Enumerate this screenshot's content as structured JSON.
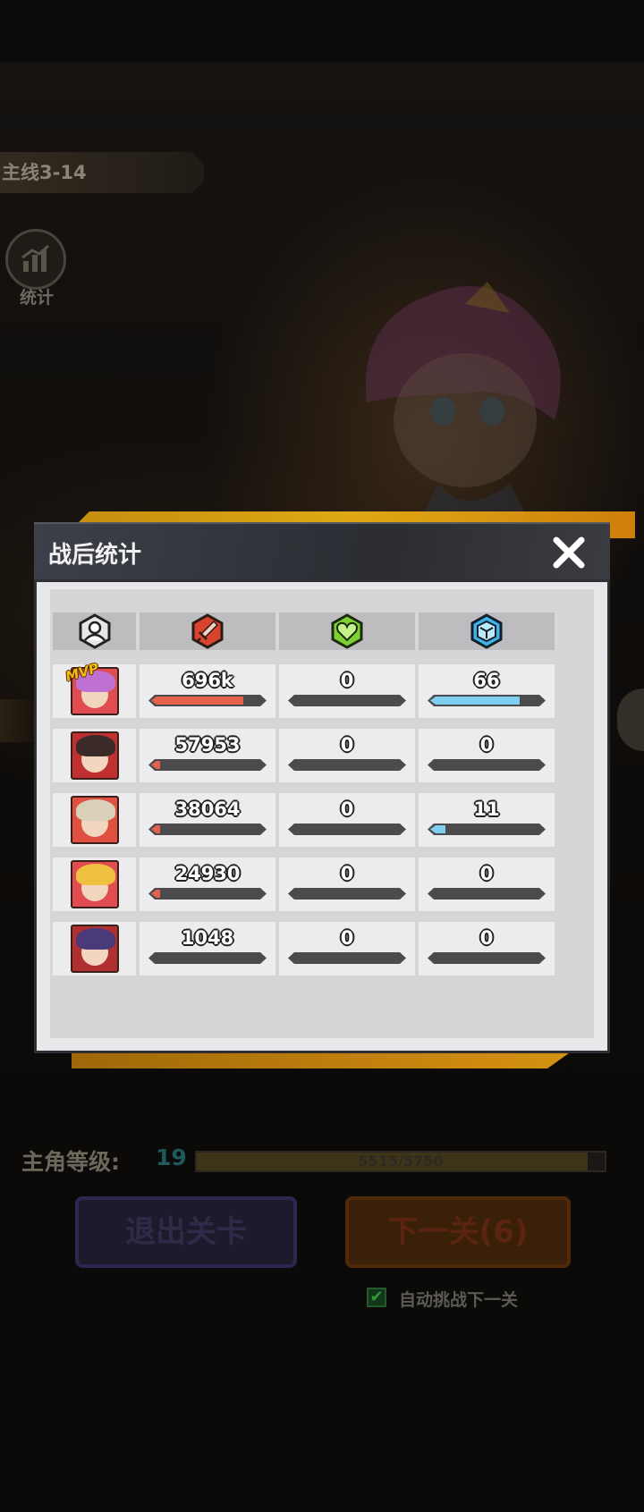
{
  "background": {
    "stage_label": "主线3-14",
    "stats_button_label": "统计"
  },
  "modal": {
    "title": "战后统计",
    "columns": [
      "hero-icon",
      "sword-icon",
      "heart-icon",
      "shield-icon"
    ],
    "mvp_label": "MVP",
    "rows": [
      {
        "avatar_colors": [
          "#c070d0",
          "#e04c50"
        ],
        "damage": "696k",
        "damage_fill": 0.87,
        "heal": "0",
        "heal_fill": 0,
        "shield": "66",
        "shield_fill": 0.85,
        "mvp": true
      },
      {
        "avatar_colors": [
          "#3a2a28",
          "#c03030"
        ],
        "damage": "57953",
        "damage_fill": 0.07,
        "heal": "0",
        "heal_fill": 0,
        "shield": "0",
        "shield_fill": 0
      },
      {
        "avatar_colors": [
          "#d8d0b8",
          "#e05040"
        ],
        "damage": "38064",
        "damage_fill": 0.05,
        "heal": "0",
        "heal_fill": 0,
        "shield": "11",
        "shield_fill": 0.14
      },
      {
        "avatar_colors": [
          "#f0c040",
          "#e04c50"
        ],
        "damage": "24930",
        "damage_fill": 0.03,
        "heal": "0",
        "heal_fill": 0,
        "shield": "0",
        "shield_fill": 0
      },
      {
        "avatar_colors": [
          "#4a3a7a",
          "#b03030"
        ],
        "damage": "1048",
        "damage_fill": 0,
        "heal": "0",
        "heal_fill": 0,
        "shield": "0",
        "shield_fill": 0
      }
    ]
  },
  "footer": {
    "level_label": "主角等级:",
    "level_value": "19",
    "xp_text": "5515/5750",
    "xp_fill": 0.959,
    "exit_button": "退出关卡",
    "next_button": "下一关(6)",
    "auto_label": "自动挑战下一关",
    "auto_checked": true
  },
  "colors": {
    "damage": "#e4624a",
    "shield": "#7ecff0",
    "bar_track": "#4b4b4d"
  }
}
